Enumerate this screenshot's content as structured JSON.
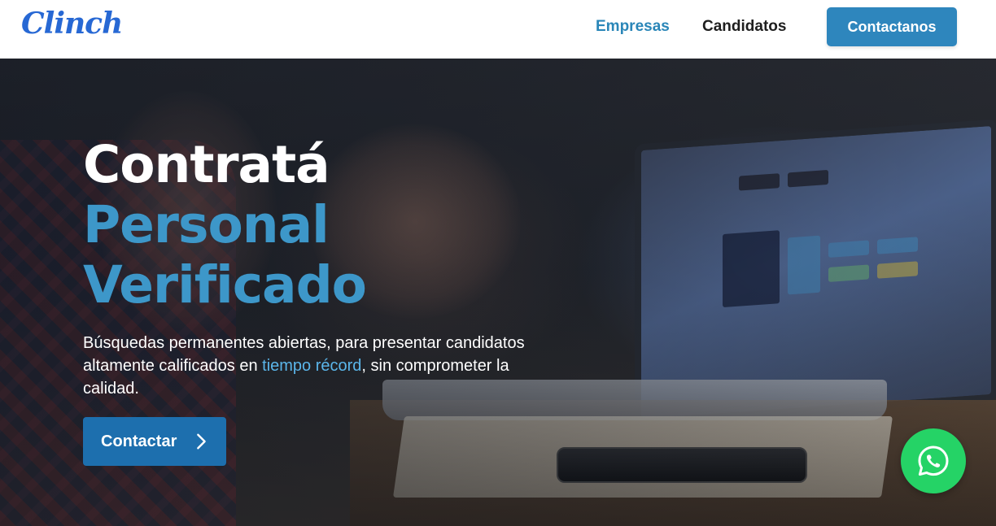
{
  "brand": {
    "logo_text": "Clinch",
    "accent": "#2e86bd"
  },
  "nav": {
    "items": [
      {
        "label": "Empresas",
        "active": true
      },
      {
        "label": "Candidatos",
        "active": false
      }
    ],
    "cta_label": "Contactanos"
  },
  "hero": {
    "title_line1": "Contratá",
    "title_line2": "Personal",
    "title_line3": "Verificado",
    "description_before": "Búsquedas permanentes abiertas, para presentar candidatos altamente calificados en ",
    "description_highlight": "tiempo récord",
    "description_after": ", sin comprometer la calidad.",
    "cta_label": "Contactar",
    "cta_icon": "chevron-right-icon",
    "highlight_color": "#5bb6ea"
  },
  "floating": {
    "whatsapp_icon": "whatsapp-icon",
    "color": "#25d366"
  }
}
